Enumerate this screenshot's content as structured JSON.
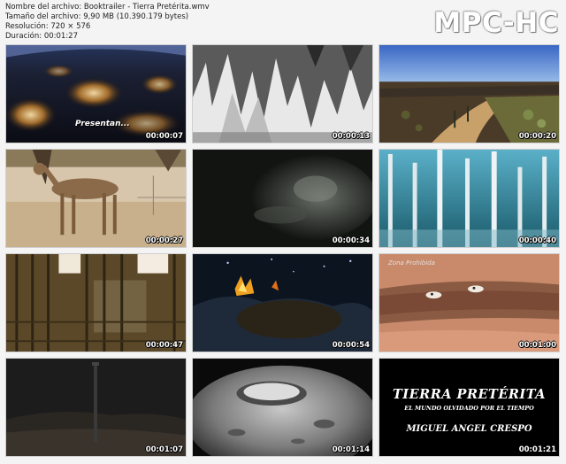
{
  "file_info": {
    "filename_line": "Nombre del archivo: Booktrailer - Tierra Pretérita.wmv",
    "size_line": "Tamaño del archivo: 9,90 MB (10.390.179 bytes)",
    "resolution_line": "Resolución: 720 × 576",
    "duration_line": "Duración: 00:01:27"
  },
  "logo": "MPC-HC",
  "thumbnails": [
    {
      "timestamp": "00:00:07",
      "caption": "Presentan..."
    },
    {
      "timestamp": "00:00:13"
    },
    {
      "timestamp": "00:00:20"
    },
    {
      "timestamp": "00:00:27"
    },
    {
      "timestamp": "00:00:34"
    },
    {
      "timestamp": "00:00:40"
    },
    {
      "timestamp": "00:00:47"
    },
    {
      "timestamp": "00:00:54"
    },
    {
      "timestamp": "00:01:00",
      "caption": "Zona Prohibida"
    },
    {
      "timestamp": "00:01:07"
    },
    {
      "timestamp": "00:01:14"
    },
    {
      "timestamp": "00:01:21",
      "title": "TIERRA PRETÉRITA",
      "subtitle": "EL MUNDO OLVIDADO POR EL TIEMPO",
      "author": "MIGUEL ANGEL CRESPO"
    }
  ]
}
